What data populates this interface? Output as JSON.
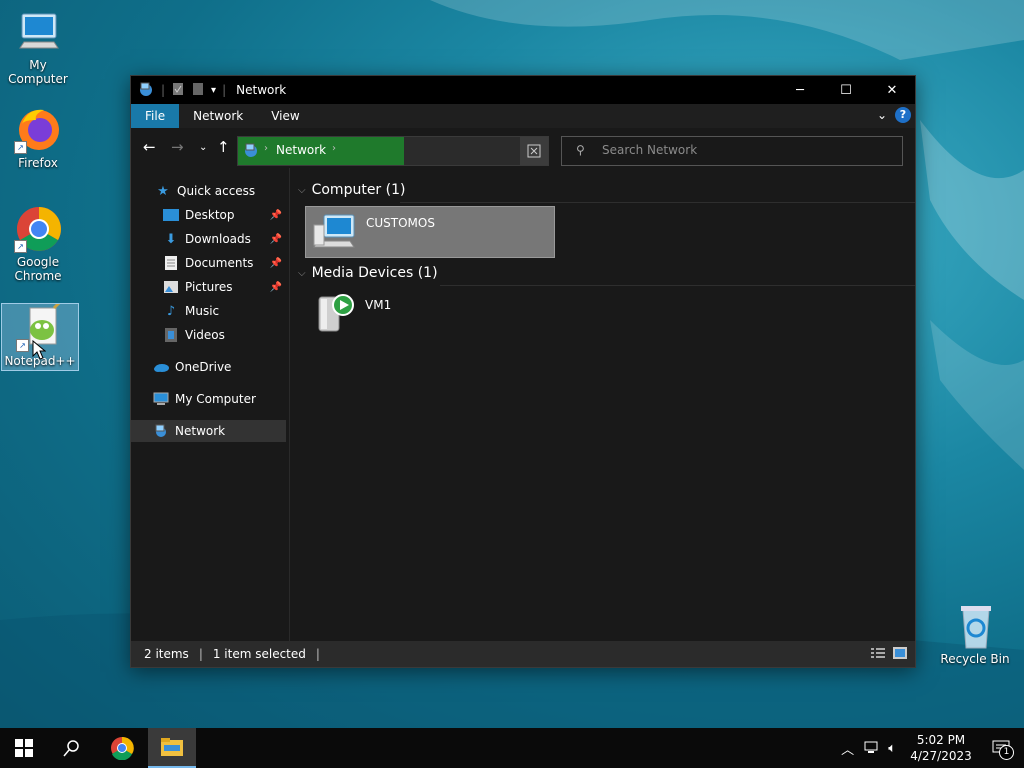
{
  "desktop": {
    "icons": [
      {
        "label": "My Computer"
      },
      {
        "label": "Firefox"
      },
      {
        "label": "Google Chrome"
      },
      {
        "label": "Notepad++"
      },
      {
        "label": "Recycle Bin"
      }
    ]
  },
  "window": {
    "title": "Network",
    "ribbon_tabs": [
      "File",
      "Network",
      "View"
    ],
    "address": {
      "segment": "Network"
    },
    "search": {
      "placeholder": "Search Network"
    },
    "nav": {
      "quick_access": "Quick access",
      "items": [
        "Desktop",
        "Downloads",
        "Documents",
        "Pictures",
        "Music",
        "Videos"
      ],
      "onedrive": "OneDrive",
      "my_computer": "My Computer",
      "network": "Network"
    },
    "groups": [
      {
        "header": "Computer (1)",
        "items": [
          "CUSTOMOS"
        ]
      },
      {
        "header": "Media Devices (1)",
        "items": [
          "VM1"
        ]
      }
    ],
    "status": {
      "items": "2 items",
      "selected": "1 item selected"
    }
  },
  "taskbar": {
    "time": "5:02 PM",
    "date": "4/27/2023",
    "notification_count": "1"
  },
  "colors": {
    "accent": "#1979a9",
    "address_highlight": "#1f7a2c",
    "selection": "#777777"
  }
}
